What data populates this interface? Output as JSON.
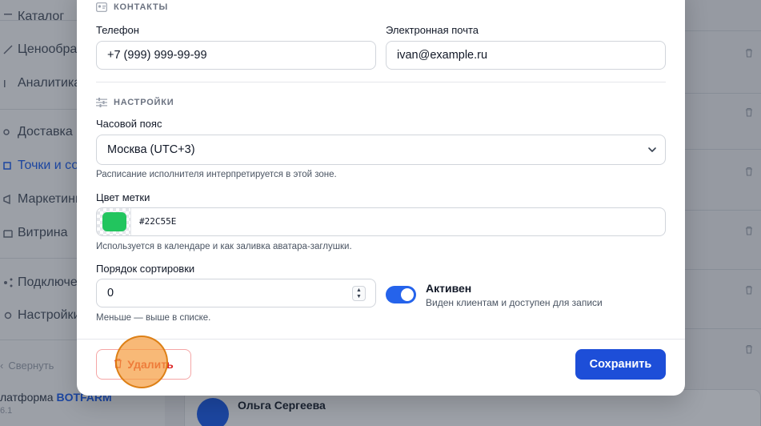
{
  "sidebar": {
    "items": [
      {
        "label": "Каталог",
        "icon": "catalog-icon"
      },
      {
        "label": "Ценообразование",
        "icon": "pricing-icon"
      },
      {
        "label": "Аналитика",
        "icon": "analytics-icon"
      },
      {
        "label": "Доставка",
        "icon": "delivery-icon"
      },
      {
        "label": "Точки и сотрудники",
        "icon": "location-icon",
        "active": true
      },
      {
        "label": "Маркетинг",
        "icon": "marketing-icon"
      },
      {
        "label": "Витрина",
        "icon": "storefront-icon"
      },
      {
        "label": "Подключения",
        "icon": "integrations-icon"
      },
      {
        "label": "Настройки",
        "icon": "settings-icon"
      }
    ],
    "collapse_label": "Свернуть",
    "brand_prefix": "латформа",
    "brand_name": "BOTFARM",
    "version": "6.1"
  },
  "background": {
    "person_name": "Ольга Сергеева"
  },
  "modal": {
    "contacts": {
      "section_title": "КОНТАКТЫ",
      "phone_label": "Телефон",
      "phone_value": "+7 (999) 999-99-99",
      "email_label": "Электронная почта",
      "email_value": "ivan@example.ru"
    },
    "settings": {
      "section_title": "НАСТРОЙКИ",
      "timezone_label": "Часовой пояс",
      "timezone_value": "Москва (UTC+3)",
      "timezone_hint": "Расписание исполнителя интерпретируется в этой зоне.",
      "color_label": "Цвет метки",
      "color_value": "#22C55E",
      "color_hint": "Используется в календаре и как заливка аватара-заглушки.",
      "sort_label": "Порядок сортировки",
      "sort_value": "0",
      "sort_hint": "Меньше — выше в списке.",
      "active_label": "Активен",
      "active_desc": "Виден клиентам и доступен для записи",
      "active_on": true
    },
    "footer": {
      "delete_label": "Удалить",
      "save_label": "Сохранить"
    }
  },
  "colors": {
    "accent": "#2563eb",
    "save_button": "#1d4ed8",
    "danger": "#dc2626",
    "label_color": "#22C55E"
  }
}
